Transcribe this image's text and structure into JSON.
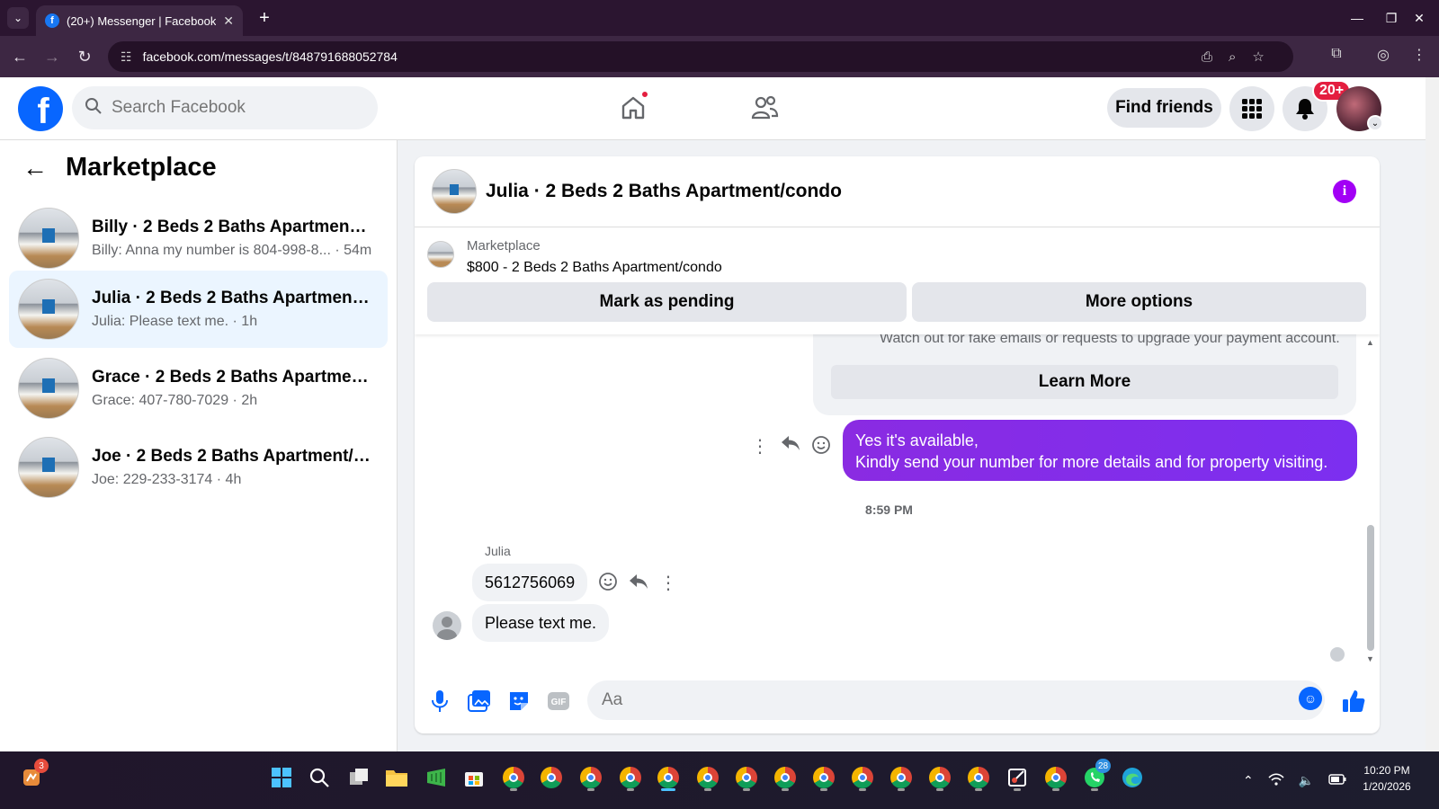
{
  "browser": {
    "tab_title": "(20+) Messenger | Facebook",
    "url": "facebook.com/messages/t/848791688052784"
  },
  "fb": {
    "search_placeholder": "Search Facebook",
    "find_friends": "Find friends",
    "notif_badge": "20+"
  },
  "sidebar": {
    "title": "Marketplace",
    "conversations": [
      {
        "name": "Billy · 2 Beds 2 Baths Apartment/c...",
        "preview": "Billy: Anna my number is 804-998-8... · 54m",
        "active": false
      },
      {
        "name": "Julia · 2 Beds 2 Baths Apartment/c...",
        "preview": "Julia: Please text me. · 1h",
        "active": true
      },
      {
        "name": "Grace · 2 Beds 2 Baths Apartment/...",
        "preview": "Grace: 407-780-7029 · 2h",
        "active": false
      },
      {
        "name": "Joe · 2 Beds 2 Baths Apartment/co...",
        "preview": "Joe: 229-233-3174 · 4h",
        "active": false
      }
    ]
  },
  "chat": {
    "title": "Julia · 2 Beds 2 Baths Apartment/condo",
    "listing_source": "Marketplace",
    "listing_price": "$800 - 2 Beds 2 Baths Apartment/condo",
    "mark_pending": "Mark as pending",
    "more_options": "More options",
    "system_text": "Watch out for fake emails or requests to upgrade your payment account.",
    "learn_more": "Learn More",
    "outgoing_line1": "Yes it's available,",
    "outgoing_line2": "Kindly send your number for more details and for property visiting.",
    "timestamp": "8:59 PM",
    "sender": "Julia",
    "incoming": [
      "5612756069",
      "Please text me."
    ],
    "composer_placeholder": "Aa"
  },
  "taskbar": {
    "clock_time": "10:20 PM",
    "clock_date": "1/20/2026",
    "widget_badge": "3",
    "whatsapp_badge": "28"
  },
  "colors": {
    "fb_blue": "#0866ff",
    "outgoing_purple": "#7c2ff0",
    "notif_red": "#e41e3f"
  }
}
